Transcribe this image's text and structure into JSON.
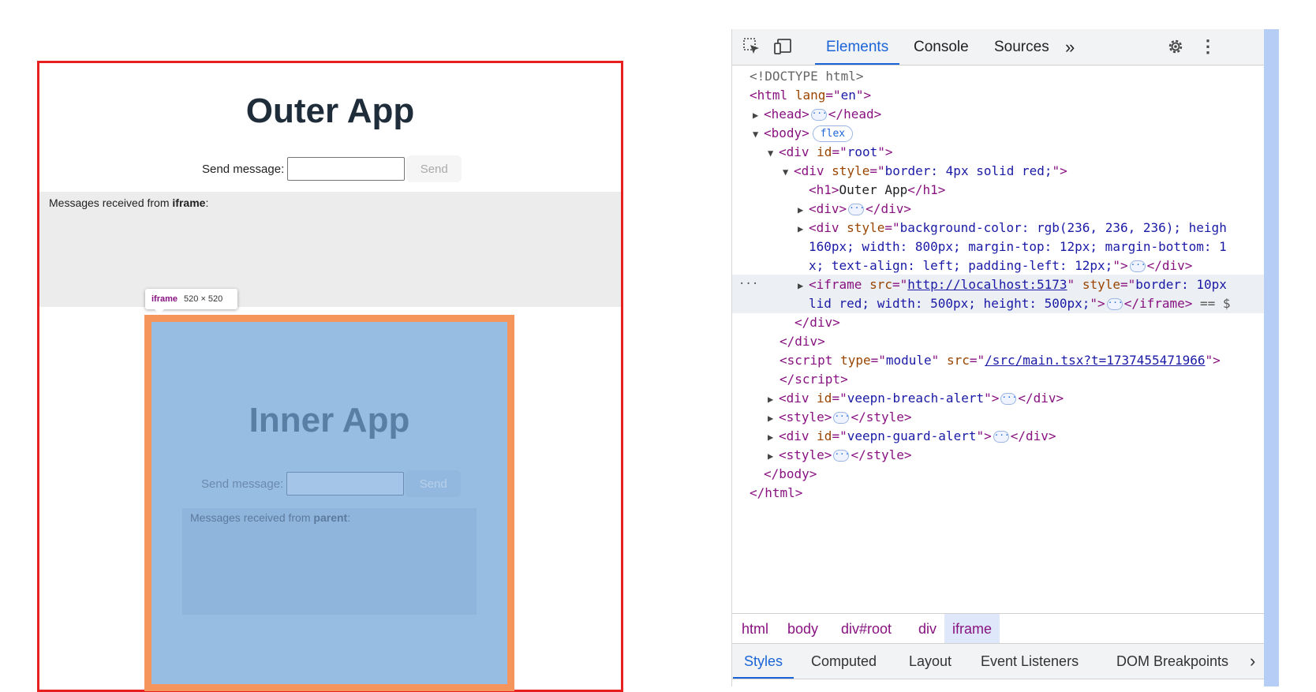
{
  "outer_app": {
    "title": "Outer App",
    "send_label": "Send message:",
    "input_value": "",
    "send_button": "Send",
    "messages_prefix": "Messages received from ",
    "messages_source": "iframe",
    "messages_suffix": ":"
  },
  "iframe_tooltip": {
    "tag": "iframe",
    "dims": "520 × 520"
  },
  "inner_app": {
    "title": "Inner App",
    "send_label": "Send message:",
    "input_value": "",
    "send_button": "Send",
    "messages_prefix": "Messages received from ",
    "messages_source": "parent",
    "messages_suffix": ":"
  },
  "devtools": {
    "toolbar": {
      "inspect_icon": "inspect-element-icon",
      "device_icon": "device-toolbar-icon",
      "tabs": [
        "Elements",
        "Console",
        "Sources"
      ],
      "more": "»",
      "settings_icon": "gear-icon",
      "menu_icon": "⋮"
    },
    "dom": {
      "doctype": "<!DOCTYPE html>",
      "html_lang": "en",
      "body_badge": "flex",
      "root_id": "root",
      "outer_div_style": "border: 4px solid red;",
      "h1_text": "Outer App",
      "styled_div_line1": "background-color: rgb(236, 236, 236); heigh",
      "styled_div_line2": "160px; width: 800px; margin-top: 12px; margin-bottom: 1",
      "styled_div_line3": "x; text-align: left; padding-left: 12px;",
      "iframe_src": "http://localhost:5173",
      "iframe_style_line1": "border: 10px",
      "iframe_style_line2": "lid red; width: 500px; height: 500px;",
      "iframe_selected_marker": "== $",
      "script_type": "module",
      "script_src": "/src/main.tsx?t=1737455471966",
      "breach_alert_id": "veepn-breach-alert",
      "guard_alert_id": "veepn-guard-alert",
      "gutter_dots": "···"
    },
    "breadcrumbs": [
      "html",
      "body",
      "div#root",
      "div",
      "iframe"
    ],
    "styles_tabs": [
      "Styles",
      "Computed",
      "Layout",
      "Event Listeners",
      "DOM Breakpoints"
    ],
    "styles_more": "›"
  },
  "colors": {
    "outer_border": "#e81f1f",
    "iframe_highlight_border": "#f5955c",
    "iframe_highlight_fill": "#97bde3",
    "devtools_accent": "#1a64d8"
  }
}
